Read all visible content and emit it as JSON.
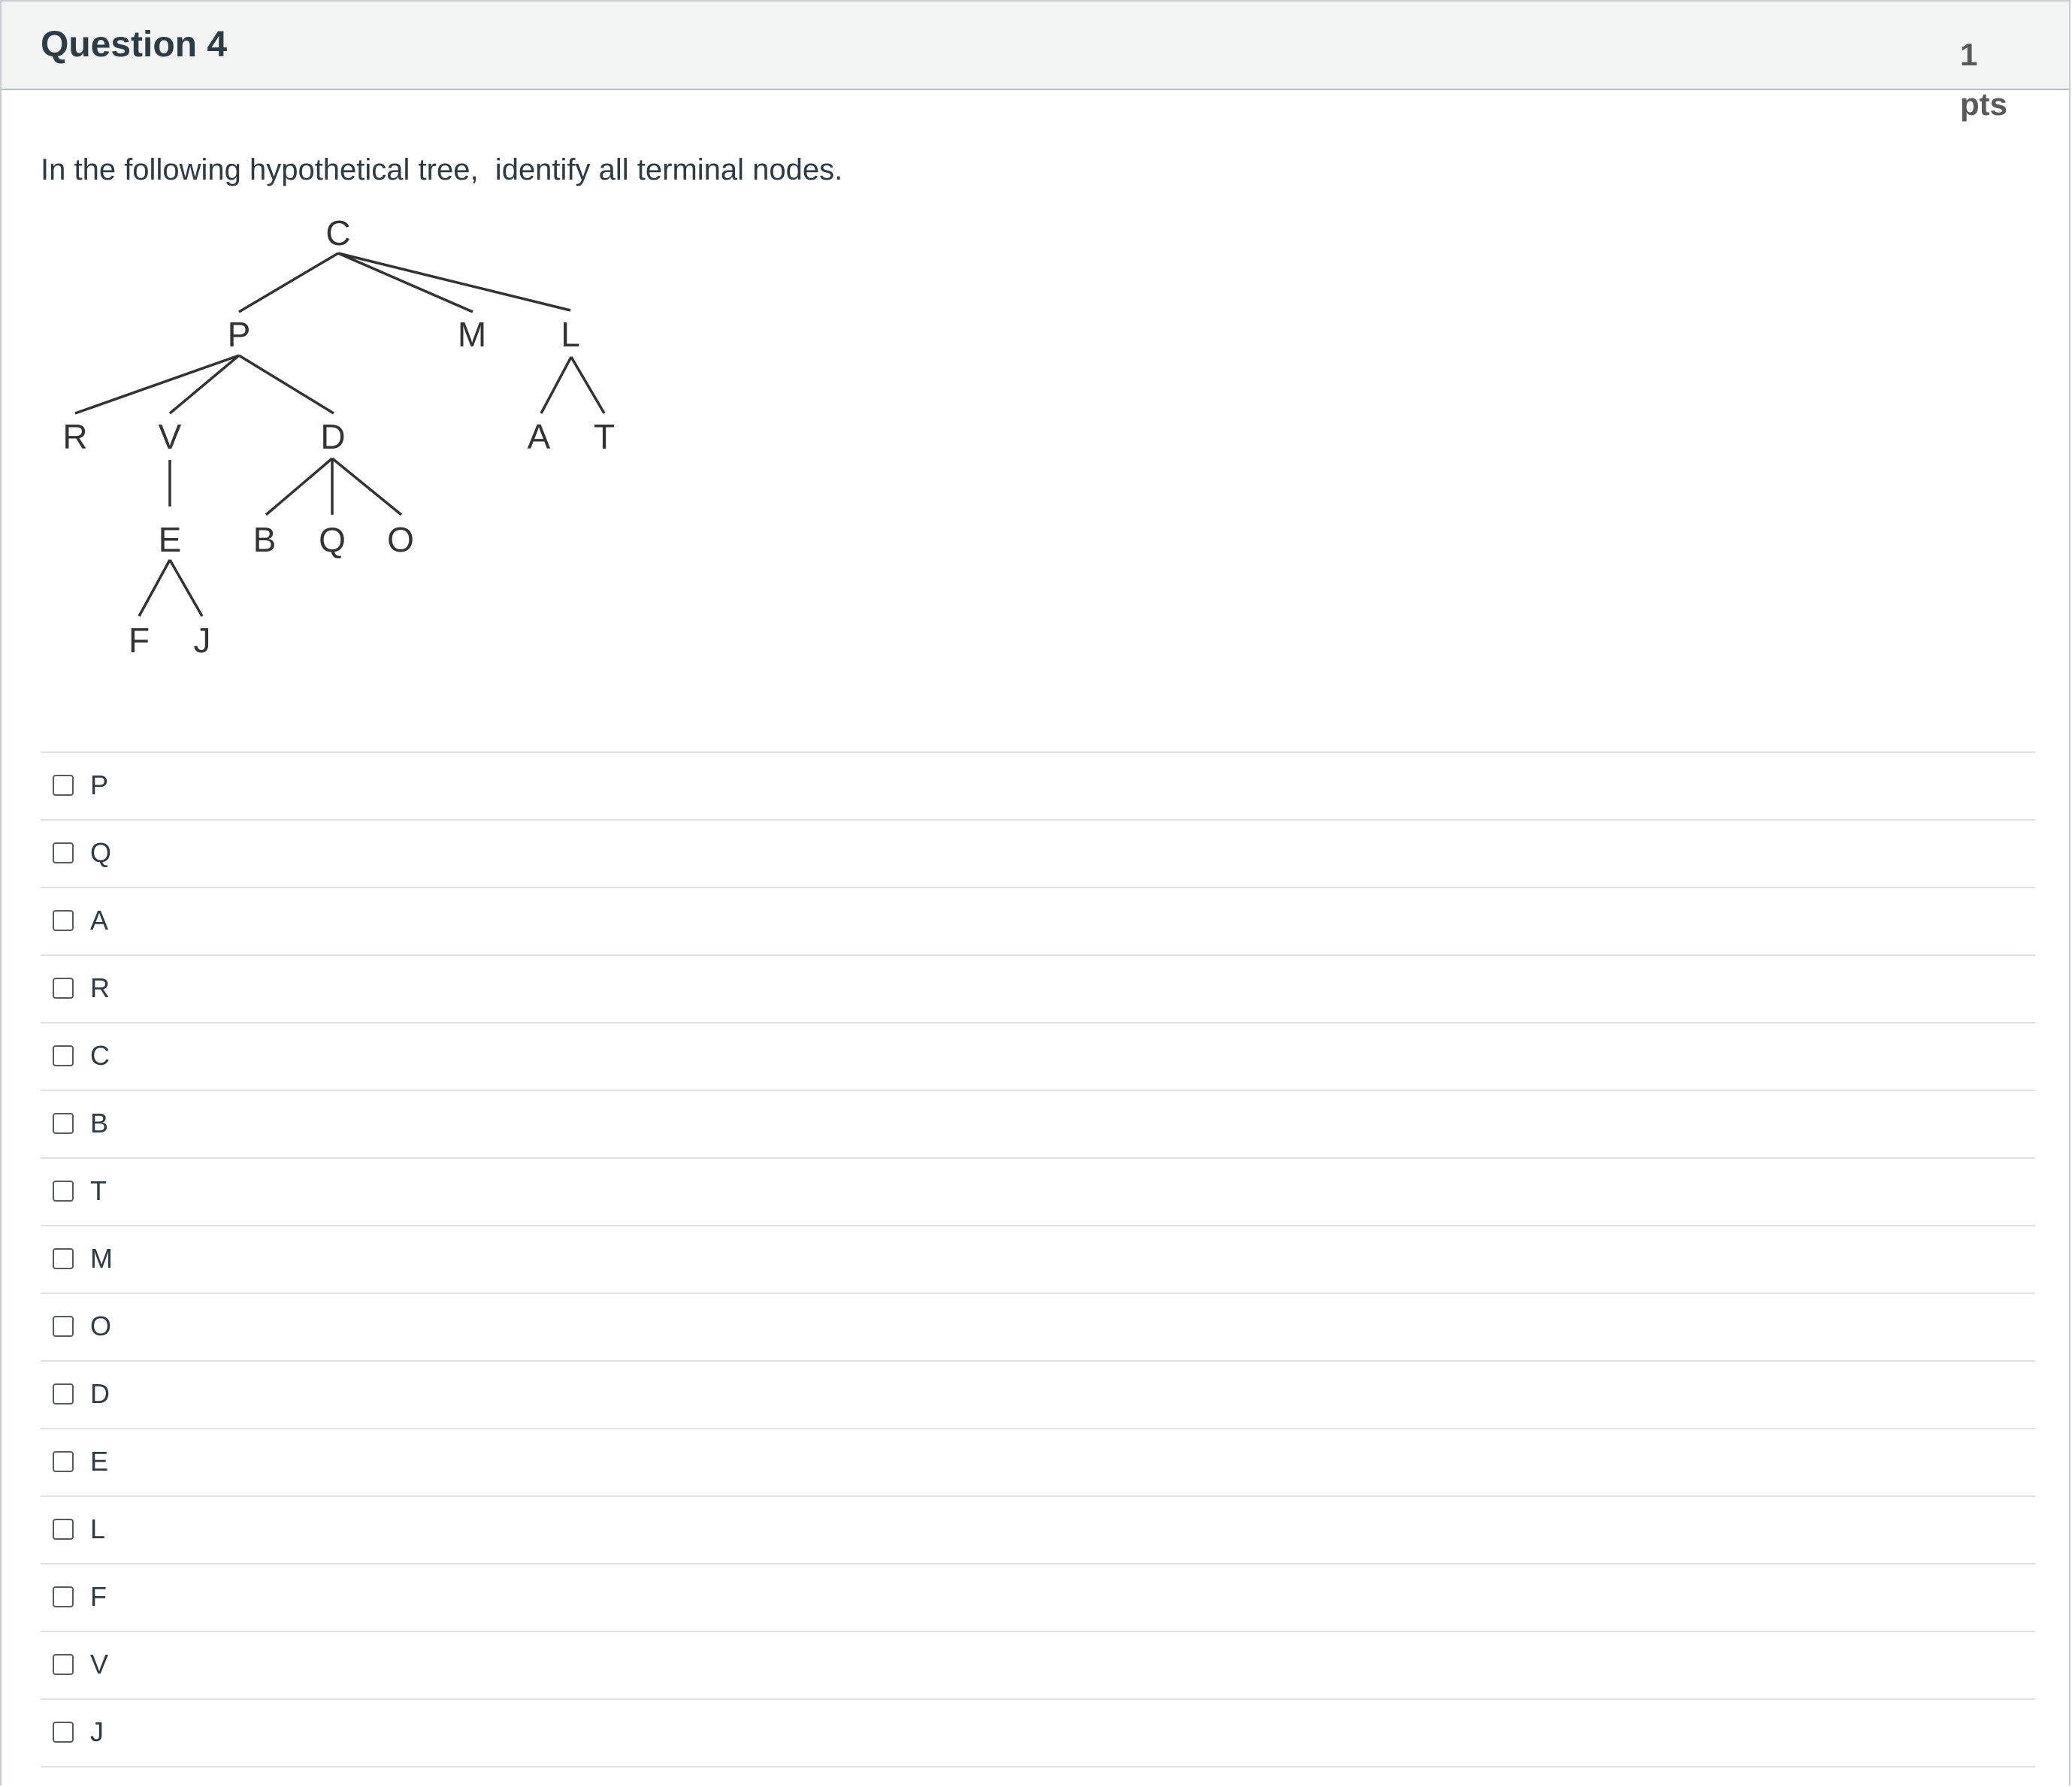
{
  "question": {
    "title": "Question 4",
    "points_value": "1",
    "points_unit": "pts",
    "prompt": "In the following hypothetical tree,  identify all terminal nodes."
  },
  "tree": {
    "nodes": {
      "C": "C",
      "P": "P",
      "M": "M",
      "L": "L",
      "R": "R",
      "V": "V",
      "D": "D",
      "A": "A",
      "T": "T",
      "E": "E",
      "B": "B",
      "Q": "Q",
      "O": "O",
      "F": "F",
      "J": "J"
    }
  },
  "answers": [
    {
      "label": "P",
      "checked": false
    },
    {
      "label": "Q",
      "checked": false
    },
    {
      "label": "A",
      "checked": false
    },
    {
      "label": "R",
      "checked": false
    },
    {
      "label": "C",
      "checked": false
    },
    {
      "label": "B",
      "checked": false
    },
    {
      "label": "T",
      "checked": false
    },
    {
      "label": "M",
      "checked": false
    },
    {
      "label": "O",
      "checked": false
    },
    {
      "label": "D",
      "checked": false
    },
    {
      "label": "E",
      "checked": false
    },
    {
      "label": "L",
      "checked": false
    },
    {
      "label": "F",
      "checked": false
    },
    {
      "label": "V",
      "checked": false
    },
    {
      "label": "J",
      "checked": false
    }
  ]
}
